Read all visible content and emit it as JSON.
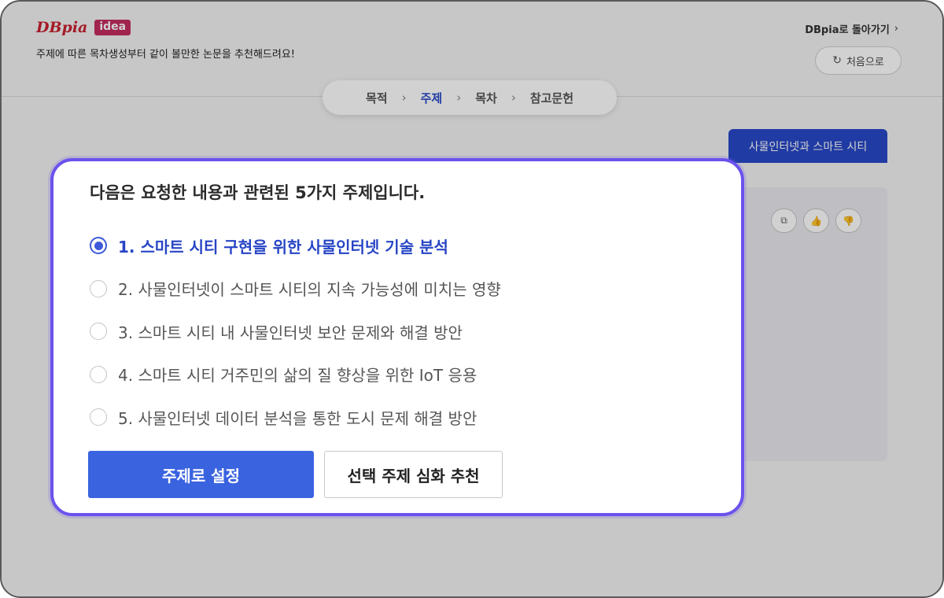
{
  "header": {
    "logo_text": "DBpia",
    "logo_badge": "idea",
    "tagline": "주제에 따른 목차생성부터 같이 볼만한 논문을 추천해드려요!",
    "back_link": "DBpia로 돌아가기",
    "back_link_icon": "chevron-right-icon",
    "reset_button": "처음으로",
    "reset_icon": "refresh-icon"
  },
  "steps": {
    "items": [
      "목적",
      "주제",
      "목차",
      "참고문헌"
    ],
    "active_index": 1,
    "separator": "›"
  },
  "chat": {
    "user_chip": "사물인터넷과 스마트 시티",
    "reaction_icons": [
      "copy-icon",
      "thumbs-up-icon",
      "thumbs-down-icon"
    ]
  },
  "modal": {
    "title": "다음은 요청한 내용과 관련된 5가지 주제입니다.",
    "options": [
      {
        "label": "1. 스마트 시티 구현을 위한 사물인터넷 기술 분석",
        "selected": true
      },
      {
        "label": "2. 사물인터넷이 스마트 시티의 지속 가능성에 미치는 영향",
        "selected": false
      },
      {
        "label": "3. 스마트 시티 내 사물인터넷 보안 문제와 해결 방안",
        "selected": false
      },
      {
        "label": "4. 스마트 시티 거주민의 삶의 질 향상을 위한 IoT 응용",
        "selected": false
      },
      {
        "label": "5. 사물인터넷 데이터 분석을 통한 도시 문제 해결 방안",
        "selected": false
      }
    ],
    "primary_button": "주제로 설정",
    "secondary_button": "선택 주제 심화 추천"
  },
  "colors": {
    "brand_red": "#c8202f",
    "accent_blue": "#3a63e0",
    "modal_border": "#6b52ee",
    "selected_text": "#2745c5"
  }
}
